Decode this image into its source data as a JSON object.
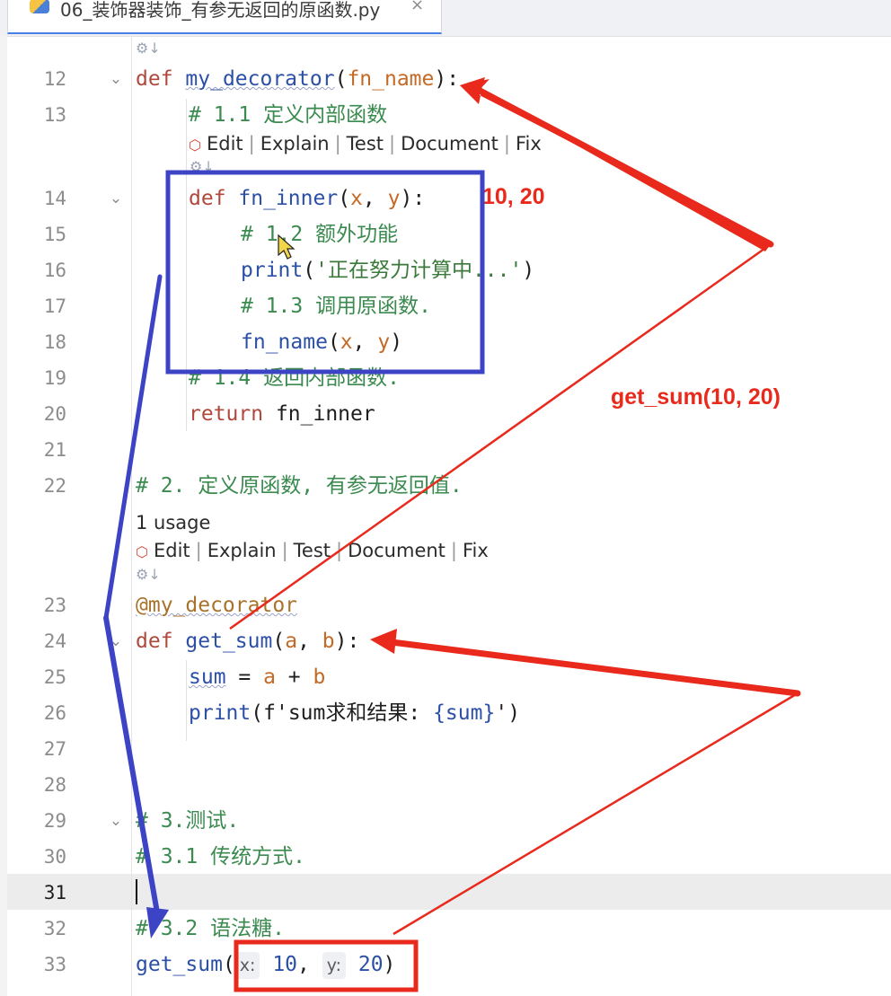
{
  "tab": {
    "title": "06_装饰器装饰_有参无返回的原函数.py",
    "close": "×"
  },
  "codelens": {
    "edit": "Edit",
    "explain": "Explain",
    "test": "Test",
    "document": "Document",
    "fix": "Fix",
    "usage": "1 usage"
  },
  "lines": {
    "l12": {
      "num": "12",
      "kw": "def",
      "name": "my_decorator",
      "open": "(",
      "param": "fn_name",
      "close": "):"
    },
    "l13": {
      "num": "13",
      "comment": "# 1.1 定义内部函数"
    },
    "l14": {
      "num": "14",
      "kw": "def",
      "name": "fn_inner",
      "open": "(",
      "p1": "x",
      "comma": ", ",
      "p2": "y",
      "close": "):"
    },
    "l15": {
      "num": "15",
      "comment": "# 1.2 额外功能"
    },
    "l16": {
      "num": "16",
      "fn": "print",
      "open": "(",
      "str": "'正在努力计算中...'",
      "close": ")"
    },
    "l17": {
      "num": "17",
      "comment": "# 1.3 调用原函数."
    },
    "l18": {
      "num": "18",
      "fn": "fn_name",
      "open": "(",
      "p1": "x",
      "comma": ", ",
      "p2": "y",
      "close": ")"
    },
    "l19": {
      "num": "19",
      "comment": "# 1.4 返回内部函数."
    },
    "l20": {
      "num": "20",
      "kw": "return",
      "rest": " fn_inner"
    },
    "l21": {
      "num": "21"
    },
    "l22": {
      "num": "22",
      "comment": "# 2. 定义原函数, 有参无返回值."
    },
    "l23": {
      "num": "23",
      "deco": "@my_decorator"
    },
    "l24": {
      "num": "24",
      "kw": "def",
      "name": "get_sum",
      "open": "(",
      "p1": "a",
      "comma": ", ",
      "p2": "b",
      "close": "):"
    },
    "l25": {
      "num": "25",
      "var": "sum",
      "op": " = ",
      "a": "a",
      "plus": " + ",
      "b": "b"
    },
    "l26": {
      "num": "26",
      "fn": "print",
      "open": "(",
      "fpre": "f'",
      "fstr": "sum求和结果: ",
      "brace_open": "{",
      "inner": "sum",
      "brace_close": "}",
      "fend": "'",
      "close": ")"
    },
    "l27": {
      "num": "27"
    },
    "l28": {
      "num": "28"
    },
    "l29": {
      "num": "29",
      "comment": "# 3.测试."
    },
    "l30": {
      "num": "30",
      "comment": "# 3.1 传统方式."
    },
    "l31": {
      "num": "31"
    },
    "l32": {
      "num": "32",
      "comment": "# 3.2 语法糖."
    },
    "l33": {
      "num": "33",
      "fn": "get_sum",
      "open": "(",
      "hint_x": "x:",
      "v1": "10",
      "comma": ", ",
      "hint_y": "y:",
      "v2": "20",
      "close": ")"
    }
  },
  "annotations": {
    "args_label": "10, 20",
    "call_label": "get_sum(10, 20)",
    "arrow_color": "#e8291c",
    "box_blue": "#3c43c4",
    "box_red": "#e8291c"
  }
}
